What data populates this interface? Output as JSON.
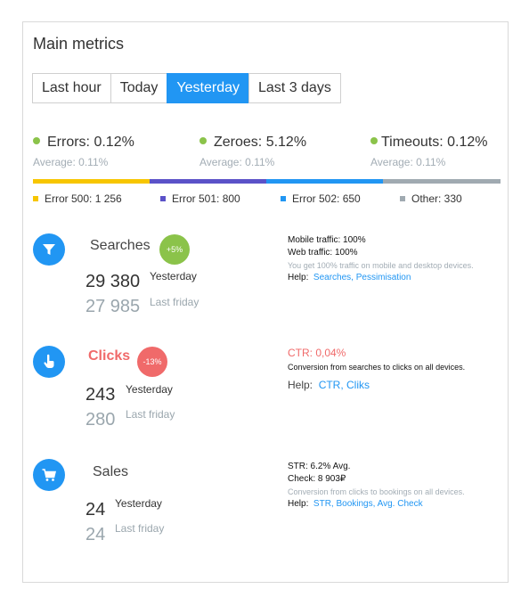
{
  "widget": {
    "title": "Main metrics",
    "tabs": [
      "Last hour",
      "Today",
      "Yesterday",
      "Last 3 days"
    ],
    "active_tab": "Yesterday"
  },
  "metrics": [
    {
      "label": "Errors: 0.12%",
      "average": "Average: 0.11%"
    },
    {
      "label": "Zeroes: 5.12%",
      "average": "Average: 0.11%"
    },
    {
      "label": "Timeouts: 0.12%",
      "average": "Average: 0.11%"
    }
  ],
  "legend": [
    {
      "label": "Error 500: 1 256",
      "color": "#f7c600"
    },
    {
      "label": "Error 501: 800",
      "color": "#5b52c8"
    },
    {
      "label": "Error 502: 650",
      "color": "#2196f3"
    },
    {
      "label": "Other: 330",
      "color": "#a0aab1"
    }
  ],
  "sections": {
    "searches": {
      "name": "Searches",
      "badge": "+5%",
      "current": "29 380",
      "current_label": "Yesterday",
      "previous": "27 985",
      "previous_label": "Last friday",
      "info1": "Mobile traffic: 100%",
      "info2": "Web traffic: 100%",
      "note": "You get 100% traffic on mobile and desktop devices.",
      "help_label": "Help:",
      "help_links": "Searches, Pessimisation"
    },
    "clicks": {
      "name": "Clicks",
      "badge": "-13%",
      "current": "243",
      "current_label": "Yesterday",
      "previous": "280",
      "previous_label": "Last friday",
      "ctr": "CTR: 0,04%",
      "note": "Conversion from searches to clicks on all devices.",
      "help_label": "Help:",
      "help_links": "CTR, Cliks"
    },
    "sales": {
      "name": "Sales",
      "current": "24",
      "current_label": "Yesterday",
      "previous": "24",
      "previous_label": "Last friday",
      "info1": "STR: 6.2% Avg.",
      "info2": "Check: 8 903₽",
      "note": "Conversion from clicks to bookings on all devices.",
      "help_label": "Help:",
      "help_links": "STR, Bookings, Avg. Check"
    }
  },
  "colors": {
    "accent": "#2196f3",
    "positive": "#8bc34a",
    "negative": "#f06a6a"
  },
  "icons": {
    "searches": "filter-icon",
    "clicks": "pointer-icon",
    "sales": "cart-icon"
  }
}
